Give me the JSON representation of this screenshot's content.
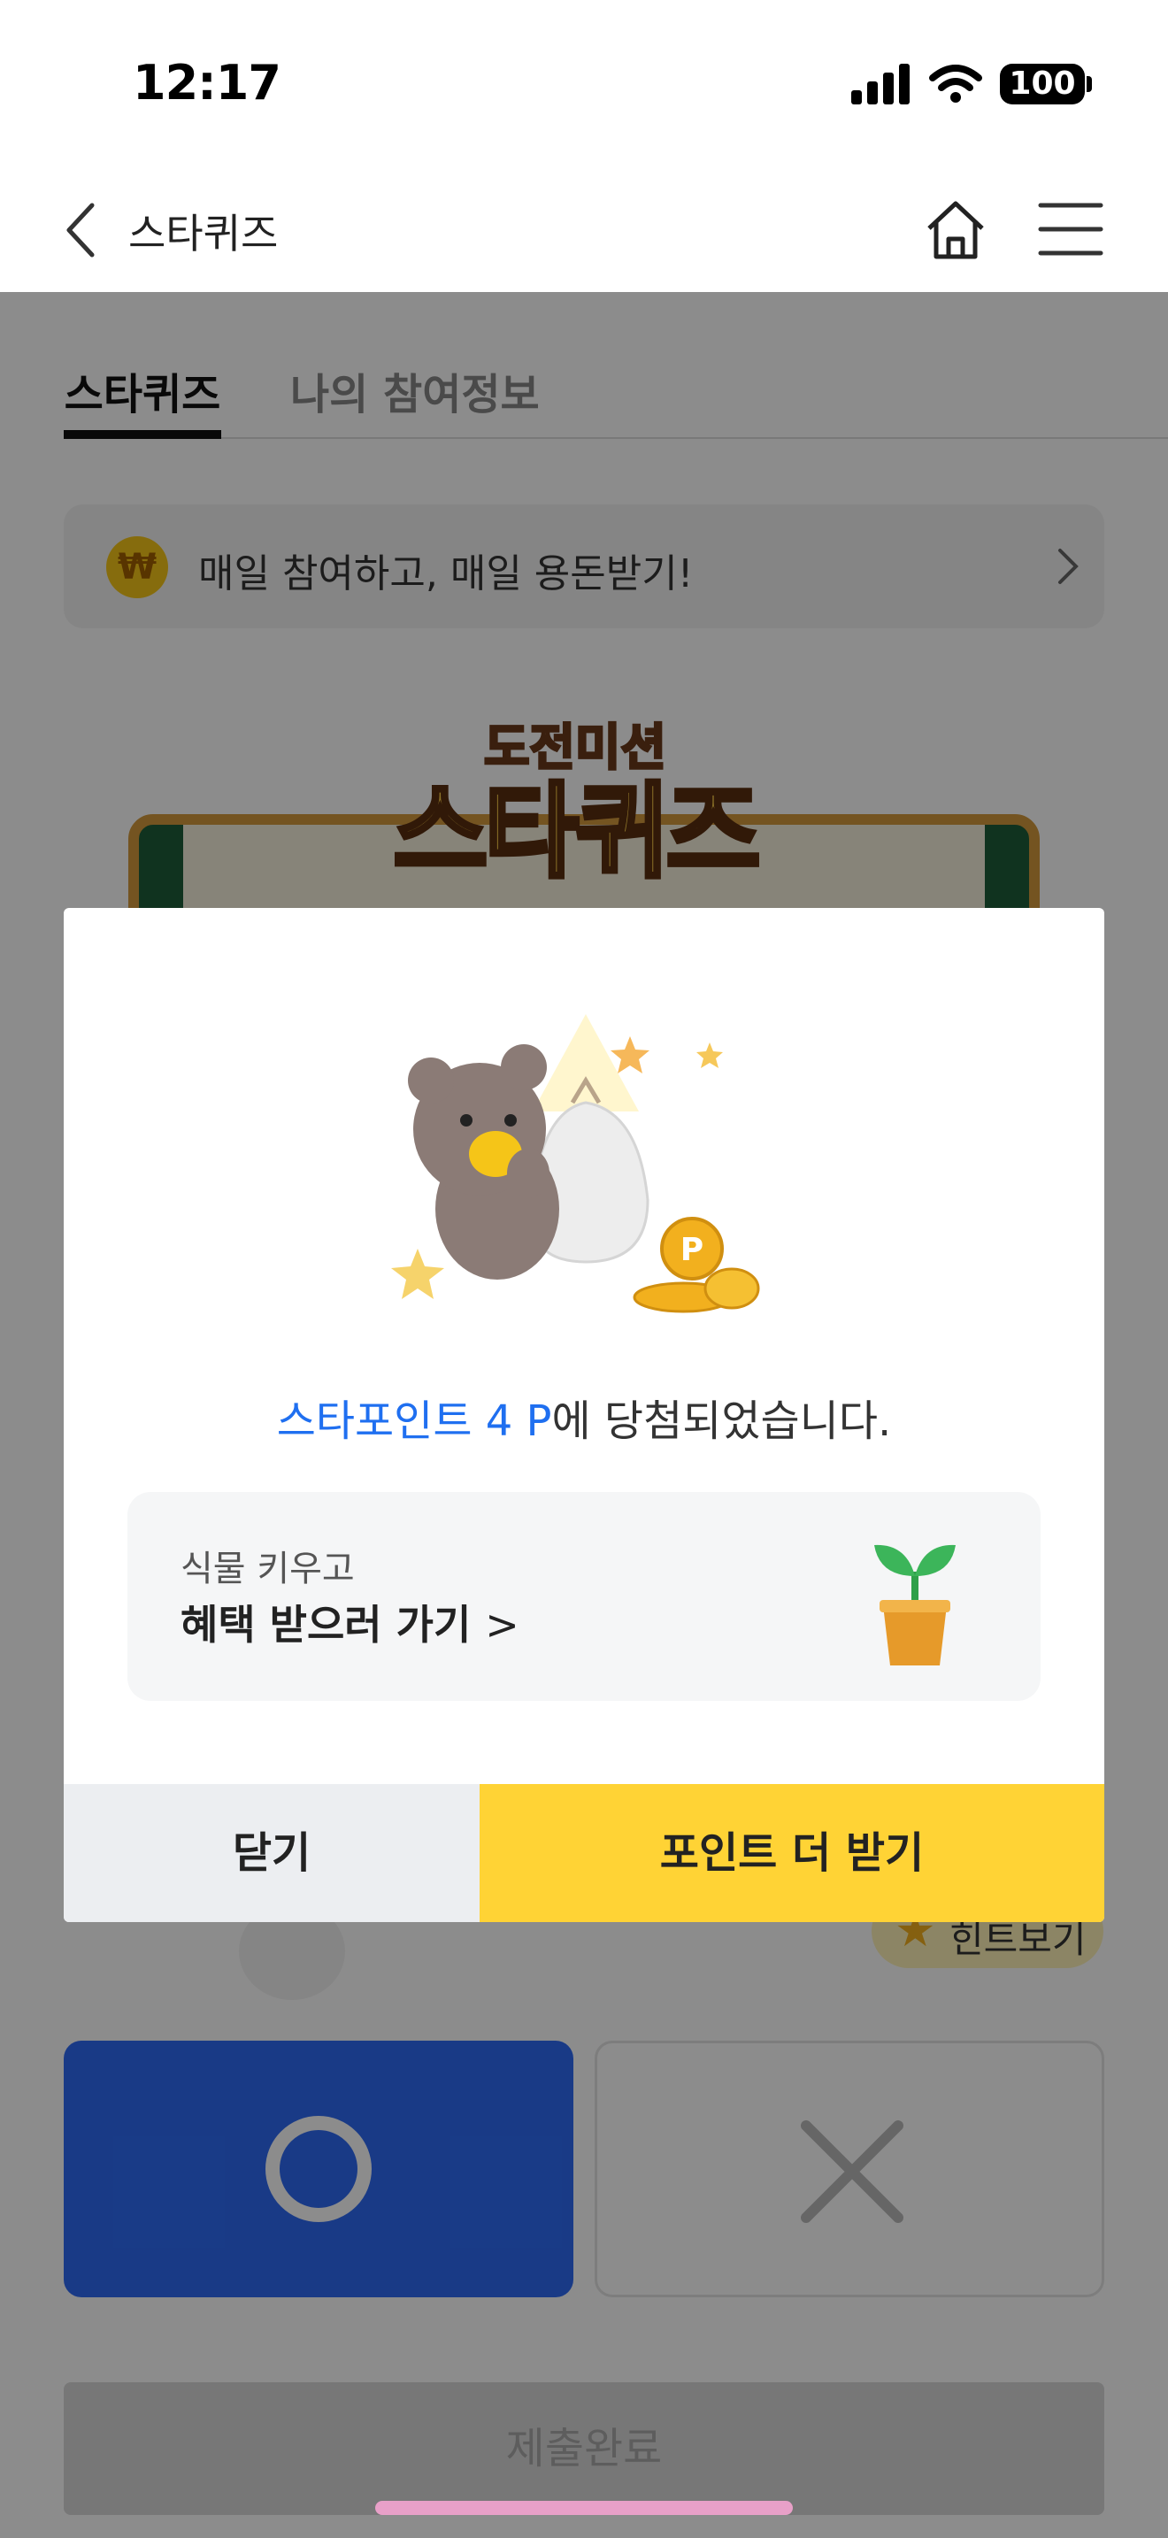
{
  "status_bar": {
    "time": "12:17",
    "battery": "100"
  },
  "header": {
    "title": "스타퀴즈"
  },
  "tabs": [
    {
      "label": "스타퀴즈"
    },
    {
      "label": "나의 참여정보"
    }
  ],
  "promo": {
    "coin": "₩",
    "text": "매일 참여하고, 매일 용돈받기!"
  },
  "banner": {
    "subtitle": "도전미션",
    "title": "스타퀴즈"
  },
  "quiz": {
    "hint_label": "힌트보기",
    "submit_label": "제출완료"
  },
  "modal": {
    "result_highlight": "스타포인트 4 P",
    "result_rest": "에 당첨되었습니다.",
    "plant_card": {
      "subtitle": "식물 키우고",
      "title": "혜택 받으러 가기",
      "chevron": ">"
    },
    "close_label": "닫기",
    "more_label": "포인트 더 받기"
  },
  "colors": {
    "accent_blue": "#1f6ff0",
    "yellow": "#ffd335",
    "o_button": "#2e6bf5"
  },
  "icons": [
    "back-arrow-icon",
    "home-icon",
    "menu-icon",
    "won-coin-icon",
    "chevron-right-icon",
    "star-icon",
    "o-icon",
    "x-icon",
    "plant-pot-icon"
  ]
}
